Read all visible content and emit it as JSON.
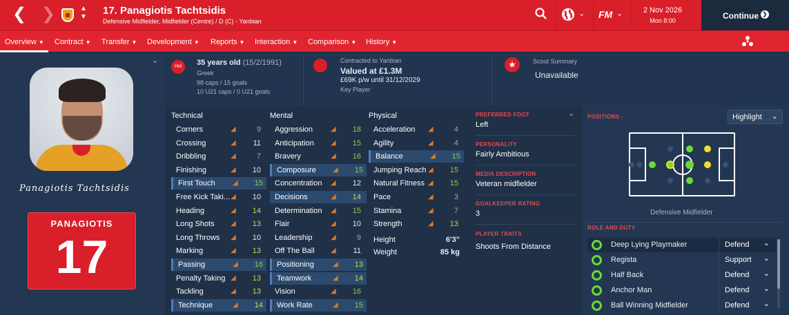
{
  "header": {
    "title": "17. Panagiotis Tachtsidis",
    "subtitle": "Defensive Midfielder, Midfielder (Centre) / D (C) - Yanbian",
    "date": "2 Nov 2026",
    "time": "Mon 8:00",
    "continue_label": "Continue",
    "fm_label": "FM"
  },
  "nav": [
    "Overview",
    "Contract",
    "Transfer",
    "Development",
    "Reports",
    "Interaction",
    "Comparison",
    "History"
  ],
  "profile": {
    "shirt_name": "PANAGIOTIS",
    "shirt_number": "17",
    "signature": "Panagiotis Tachtsidis"
  },
  "personal": {
    "nation_code": "Hol",
    "age": "35 years old",
    "dob": "(15/2/1991)",
    "nationality": "Greek",
    "caps": "98 caps / 15 goals",
    "u21": "10 U21 caps / 0 U21 goals"
  },
  "contract": {
    "label": "Contracted to Yanbian",
    "value": "Valued at £1.3M",
    "wage": "£69K p/w until 31/12/2029",
    "status": "Key Player"
  },
  "scout": {
    "label": "Scout Summary",
    "value": "Unavailable"
  },
  "technical": {
    "title": "Technical",
    "rows": [
      [
        "Corners",
        "9"
      ],
      [
        "Crossing",
        "11"
      ],
      [
        "Dribbling",
        "7"
      ],
      [
        "Finishing",
        "10"
      ],
      [
        "First Touch",
        "15"
      ],
      [
        "Free Kick Taki...",
        "10"
      ],
      [
        "Heading",
        "14"
      ],
      [
        "Long Shots",
        "13"
      ],
      [
        "Long Throws",
        "10"
      ],
      [
        "Marking",
        "13"
      ],
      [
        "Passing",
        "16"
      ],
      [
        "Penalty Taking",
        "13"
      ],
      [
        "Tackling",
        "13"
      ],
      [
        "Technique",
        "14"
      ]
    ]
  },
  "mental": {
    "title": "Mental",
    "rows": [
      [
        "Aggression",
        "18"
      ],
      [
        "Anticipation",
        "15"
      ],
      [
        "Bravery",
        "16"
      ],
      [
        "Composure",
        "15"
      ],
      [
        "Concentration",
        "12"
      ],
      [
        "Decisions",
        "14"
      ],
      [
        "Determination",
        "15"
      ],
      [
        "Flair",
        "10"
      ],
      [
        "Leadership",
        "9"
      ],
      [
        "Off The Ball",
        "11"
      ],
      [
        "Positioning",
        "13"
      ],
      [
        "Teamwork",
        "14"
      ],
      [
        "Vision",
        "16"
      ],
      [
        "Work Rate",
        "15"
      ]
    ]
  },
  "physical": {
    "title": "Physical",
    "rows": [
      [
        "Acceleration",
        "4"
      ],
      [
        "Agility",
        "4"
      ],
      [
        "Balance",
        "15"
      ],
      [
        "Jumping Reach",
        "15"
      ],
      [
        "Natural Fitness",
        "15"
      ],
      [
        "Pace",
        "3"
      ],
      [
        "Stamina",
        "7"
      ],
      [
        "Strength",
        "13"
      ]
    ],
    "height_label": "Height",
    "height": "6'3\"",
    "weight_label": "Weight",
    "weight": "85 kg"
  },
  "details": {
    "foot_label": "PREFERRED FOOT",
    "foot": "Left",
    "personality_label": "PERSONALITY",
    "personality": "Fairly Ambitious",
    "media_label": "MEDIA DESCRIPTION",
    "media": "Veteran midfielder",
    "gk_label": "GOALKEEPER RATING",
    "gk": "3",
    "traits_label": "PLAYER TRAITS",
    "traits": "Shoots From Distance"
  },
  "positions": {
    "label": "POSITIONS",
    "highlight": "Highlight",
    "position_name": "Defensive Midfielder",
    "role_label": "ROLE AND DUTY",
    "roles": [
      [
        "Deep Lying Playmaker",
        "Defend"
      ],
      [
        "Regista",
        "Support"
      ],
      [
        "Half Back",
        "Defend"
      ],
      [
        "Anchor Man",
        "Defend"
      ],
      [
        "Ball Winning Midfielder",
        "Defend"
      ]
    ]
  },
  "colors": {
    "red": "#d81f2a",
    "panel": "#233753",
    "green": "#6cdb34",
    "yellow": "#f2e02a"
  }
}
